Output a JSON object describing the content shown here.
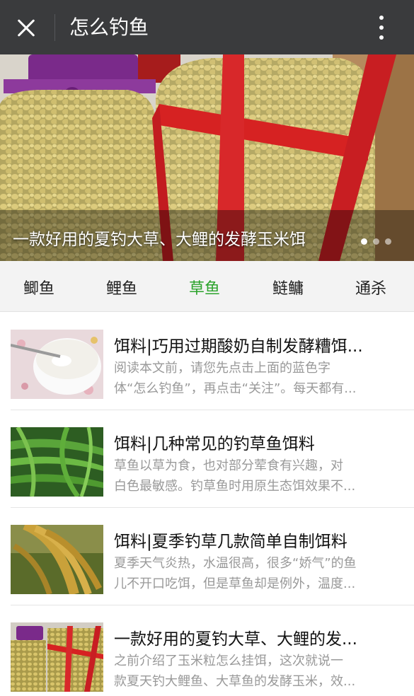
{
  "titlebar": {
    "title": "怎么钓鱼",
    "close_icon": "close-icon",
    "more_icon": "more-vertical-icon"
  },
  "banner": {
    "caption": "一款好用的夏钓大草、大鲤的发酵玉米饵",
    "slides_total": 3,
    "active_slide": 1
  },
  "tabs": [
    {
      "label": "鲫鱼",
      "active": false
    },
    {
      "label": "鲤鱼",
      "active": false
    },
    {
      "label": "草鱼",
      "active": true
    },
    {
      "label": "鲢鳙",
      "active": false
    },
    {
      "label": "通杀",
      "active": false
    }
  ],
  "colors": {
    "titlebar_bg": "#3a3b3d",
    "active_tab": "#2ba32b",
    "text_primary": "#111111",
    "text_secondary": "#999999"
  },
  "articles": [
    {
      "title": "饵料|巧用过期酸奶自制发酵糟饵...",
      "desc_line1": "阅读本文前，请您先点击上面的蓝色字",
      "desc_line2": "体“怎么钓鱼”，再点击“关注”。每天都有...",
      "thumb": "yogurt-bowl-image"
    },
    {
      "title": "饵料|几种常见的钓草鱼饵料",
      "desc_line1": "草鱼以草为食，也对部分荤食有兴趣，对",
      "desc_line2": "白色最敏感。钓草鱼时用原生态饵效果不...",
      "thumb": "green-grass-image"
    },
    {
      "title": "饵料|夏季钓草几款简单自制饵料",
      "desc_line1": "夏季天气炎热，水温很高，很多“娇气”的鱼",
      "desc_line2": "儿不开口吃饵，但是草鱼却是例外，温度...",
      "thumb": "rice-ears-image"
    },
    {
      "title": "一款好用的夏钓大草、大鲤的发...",
      "desc_line1": "之前介绍了玉米粒怎么挂饵，这次就说一",
      "desc_line2": "款夏天钓大鲤鱼、大草鱼的发酵玉米，效...",
      "thumb": "corn-jars-image"
    }
  ]
}
